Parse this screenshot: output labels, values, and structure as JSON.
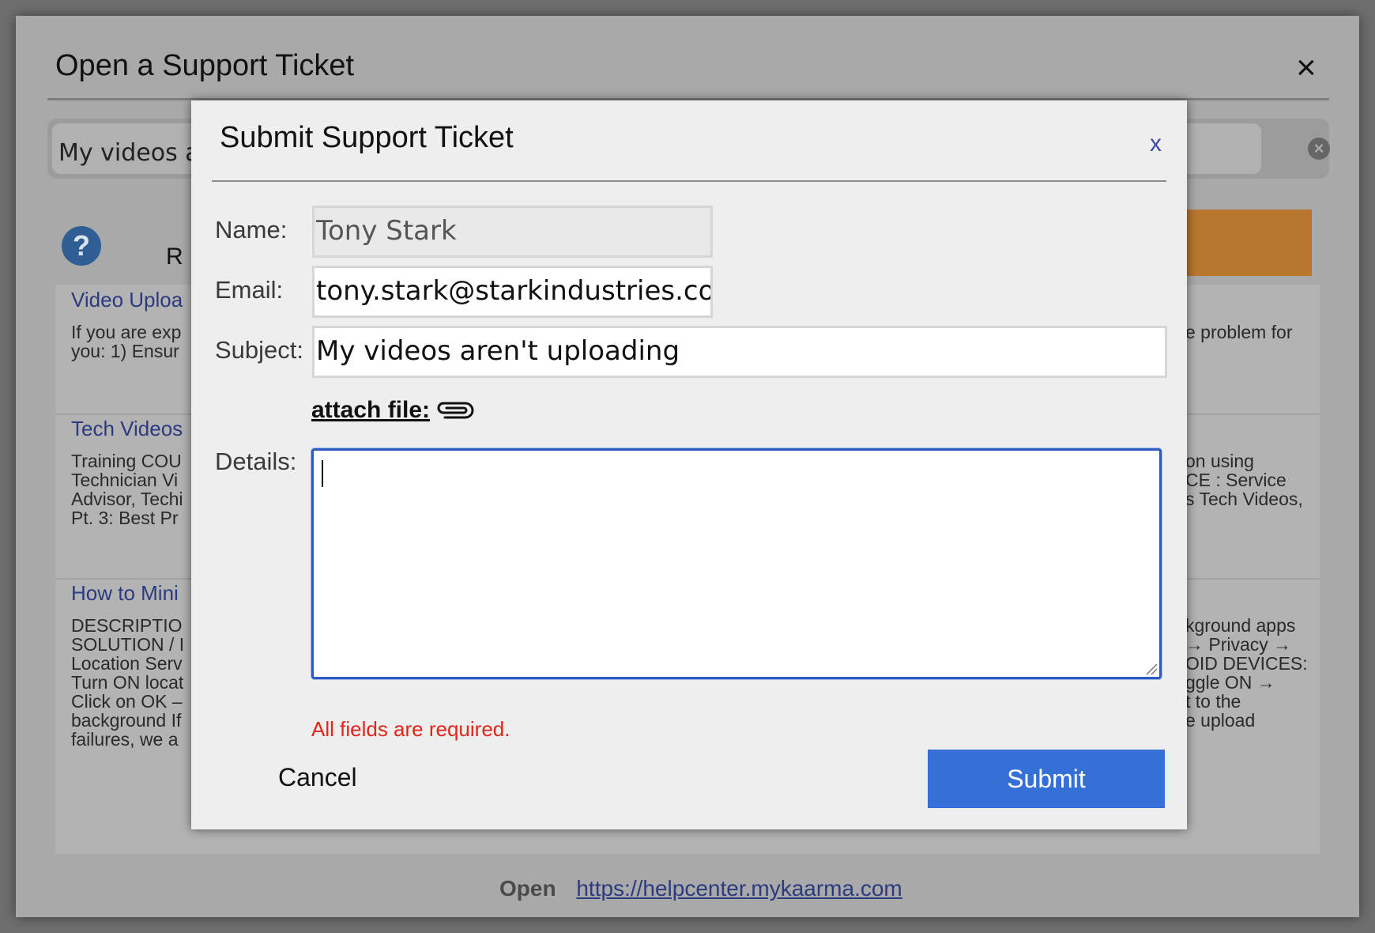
{
  "background": {
    "title": "Open a Support Ticket",
    "close_glyph": "×",
    "search": {
      "value": "My videos ar",
      "clear_icon": "clear-icon"
    },
    "help_icon": "question-icon",
    "results_label": "R",
    "items": [
      {
        "title": "Video Uploa",
        "left_text": "If you are exp\nyou: 1) Ensur",
        "right_text": "e problem for"
      },
      {
        "title": "Tech Videos",
        "left_text": "Training COU\nTechnician Vi\nAdvisor, Techi\nPt. 3: Best Pr",
        "right_text": "on using\nCE : Service\ns Tech Videos,"
      },
      {
        "title": "How to Mini",
        "left_text": "DESCRIPTIO\nSOLUTION / I\nLocation Serv\nTurn ON locat\nClick on OK –\nbackground If\nfailures, we a",
        "right_text": "kground apps\n→ Privacy →\nOID DEVICES:\nggle ON →\nt to the\ne upload"
      }
    ],
    "footer": {
      "open_label": "Open",
      "link": "https://helpcenter.mykaarma.com"
    },
    "accent_orange": "#b8772e"
  },
  "dialog": {
    "title": "Submit Support Ticket",
    "close_label": "x",
    "fields": {
      "name_label": "Name:",
      "name_value": "Tony Stark",
      "email_label": "Email:",
      "email_value": "tony.stark@starkindustries.com",
      "subject_label": "Subject:",
      "subject_value": "My videos aren't uploading",
      "details_label": "Details:",
      "details_value": ""
    },
    "attach_label": "attach file:",
    "attach_icon": "paperclip-icon",
    "error_message": "All fields are required.",
    "cancel_label": "Cancel",
    "submit_label": "Submit",
    "colors": {
      "submit": "#3570d6",
      "error": "#e0261a",
      "focus_border": "#2a5cc4",
      "close": "#3b4ca8"
    }
  }
}
